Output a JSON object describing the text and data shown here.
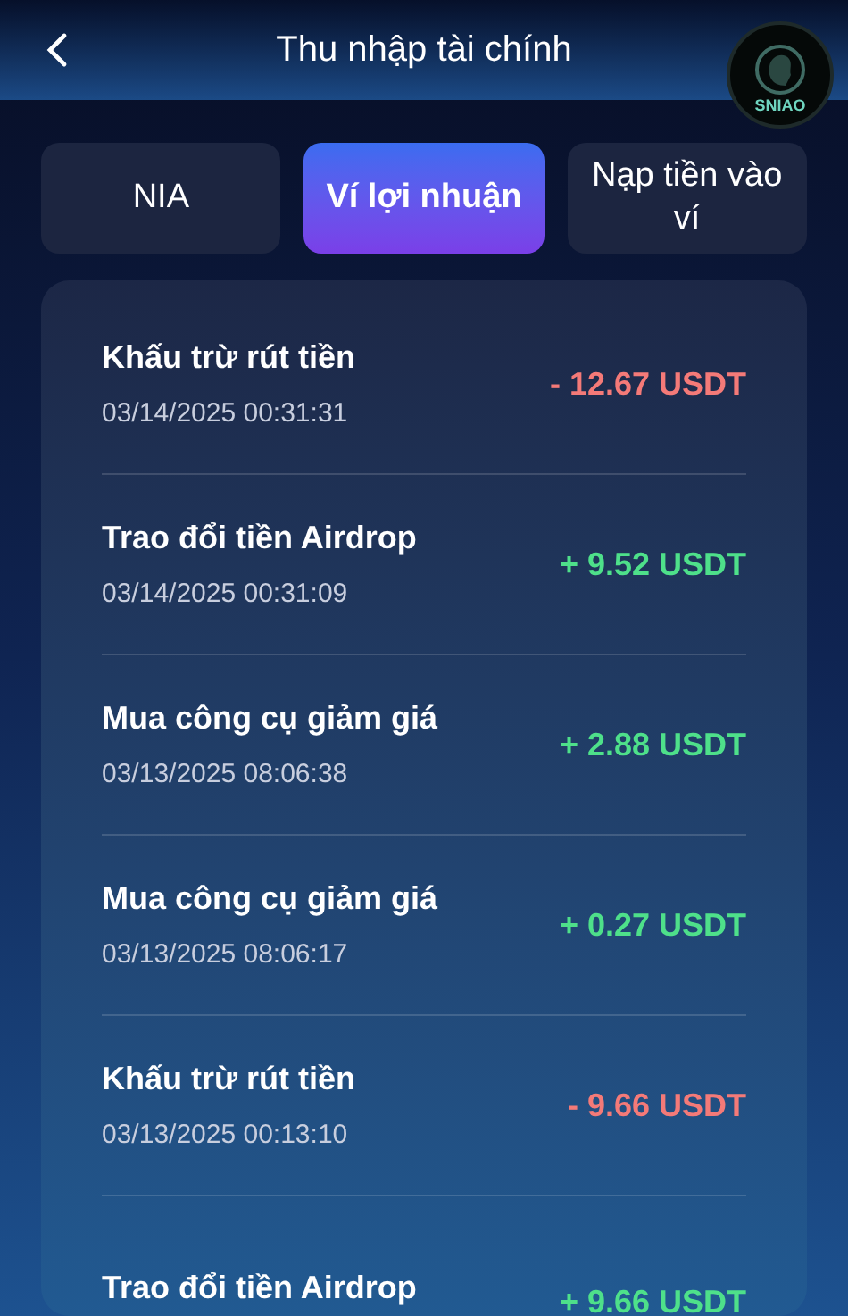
{
  "header": {
    "title": "Thu nhập tài chính",
    "logo_text": "SNIAO"
  },
  "tabs": [
    {
      "label": "NIA",
      "selected": false
    },
    {
      "label": "Ví lợi nhuận",
      "selected": true
    },
    {
      "label": "Nạp tiền vào ví",
      "selected": false
    }
  ],
  "transactions": [
    {
      "title": "Khấu trừ rút tiền",
      "date": "03/14/2025 00:31:31",
      "amount": "- 12.67 USDT",
      "kind": "debit"
    },
    {
      "title": "Trao đổi tiền Airdrop",
      "date": "03/14/2025 00:31:09",
      "amount": "+ 9.52 USDT",
      "kind": "credit"
    },
    {
      "title": "Mua công cụ giảm giá",
      "date": "03/13/2025 08:06:38",
      "amount": "+ 2.88 USDT",
      "kind": "credit"
    },
    {
      "title": "Mua công cụ giảm giá",
      "date": "03/13/2025 08:06:17",
      "amount": "+ 0.27 USDT",
      "kind": "credit"
    },
    {
      "title": "Khấu trừ rút tiền",
      "date": "03/13/2025 00:13:10",
      "amount": "- 9.66 USDT",
      "kind": "debit"
    },
    {
      "title": "Trao đổi tiền Airdrop",
      "amount": "+ 9.66 USDT",
      "kind": "credit"
    }
  ]
}
